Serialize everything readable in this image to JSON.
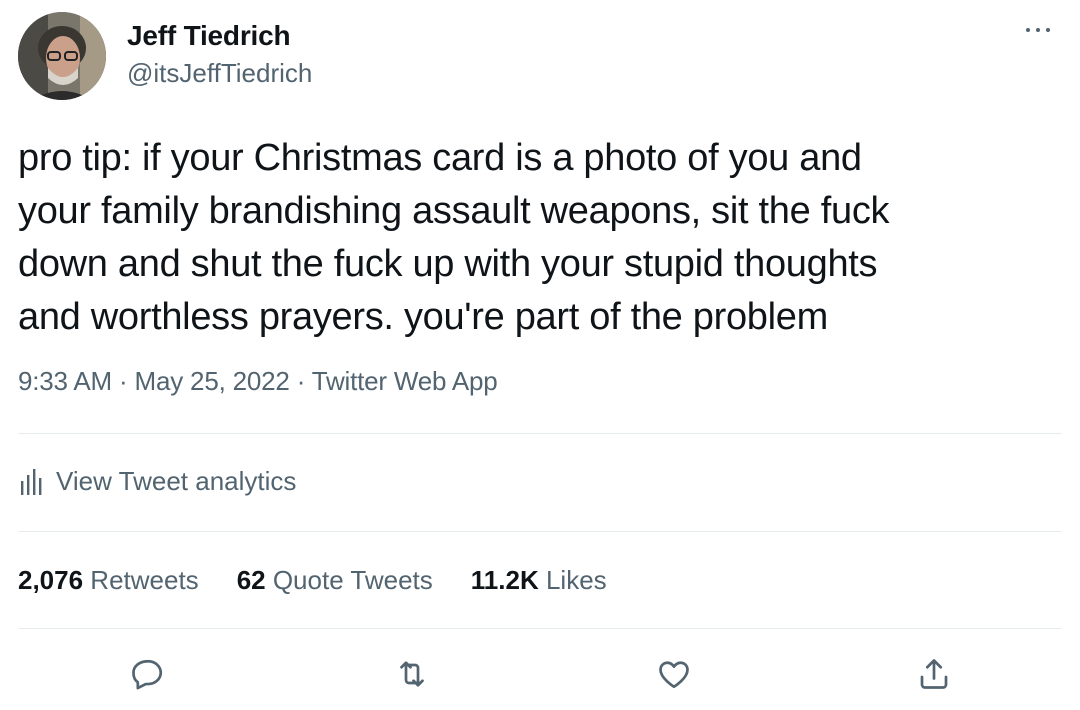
{
  "tweet": {
    "author": {
      "name": "Jeff Tiedrich",
      "handle": "@itsJeffTiedrich"
    },
    "text_lines": [
      "pro tip: if your Christmas card is a photo of you and",
      "your family brandishing assault weapons, sit the fuck",
      "down and shut the fuck up with your stupid thoughts",
      "and worthless prayers. you're part of the problem"
    ],
    "time": "9:33 AM",
    "separator": " · ",
    "date": "May 25, 2022",
    "source": "Twitter Web App",
    "analytics_label": "View Tweet analytics",
    "stats": {
      "retweets_count": "2,076",
      "retweets_label": " Retweets",
      "quotes_count": "62",
      "quotes_label": " Quote Tweets",
      "likes_count": "11.2K",
      "likes_label": " Likes"
    },
    "actions": [
      "reply-icon",
      "retweet-icon",
      "like-icon",
      "share-icon"
    ]
  },
  "colors": {
    "text": "#0f1419",
    "secondary": "#536471",
    "divider": "#e6ebee"
  }
}
